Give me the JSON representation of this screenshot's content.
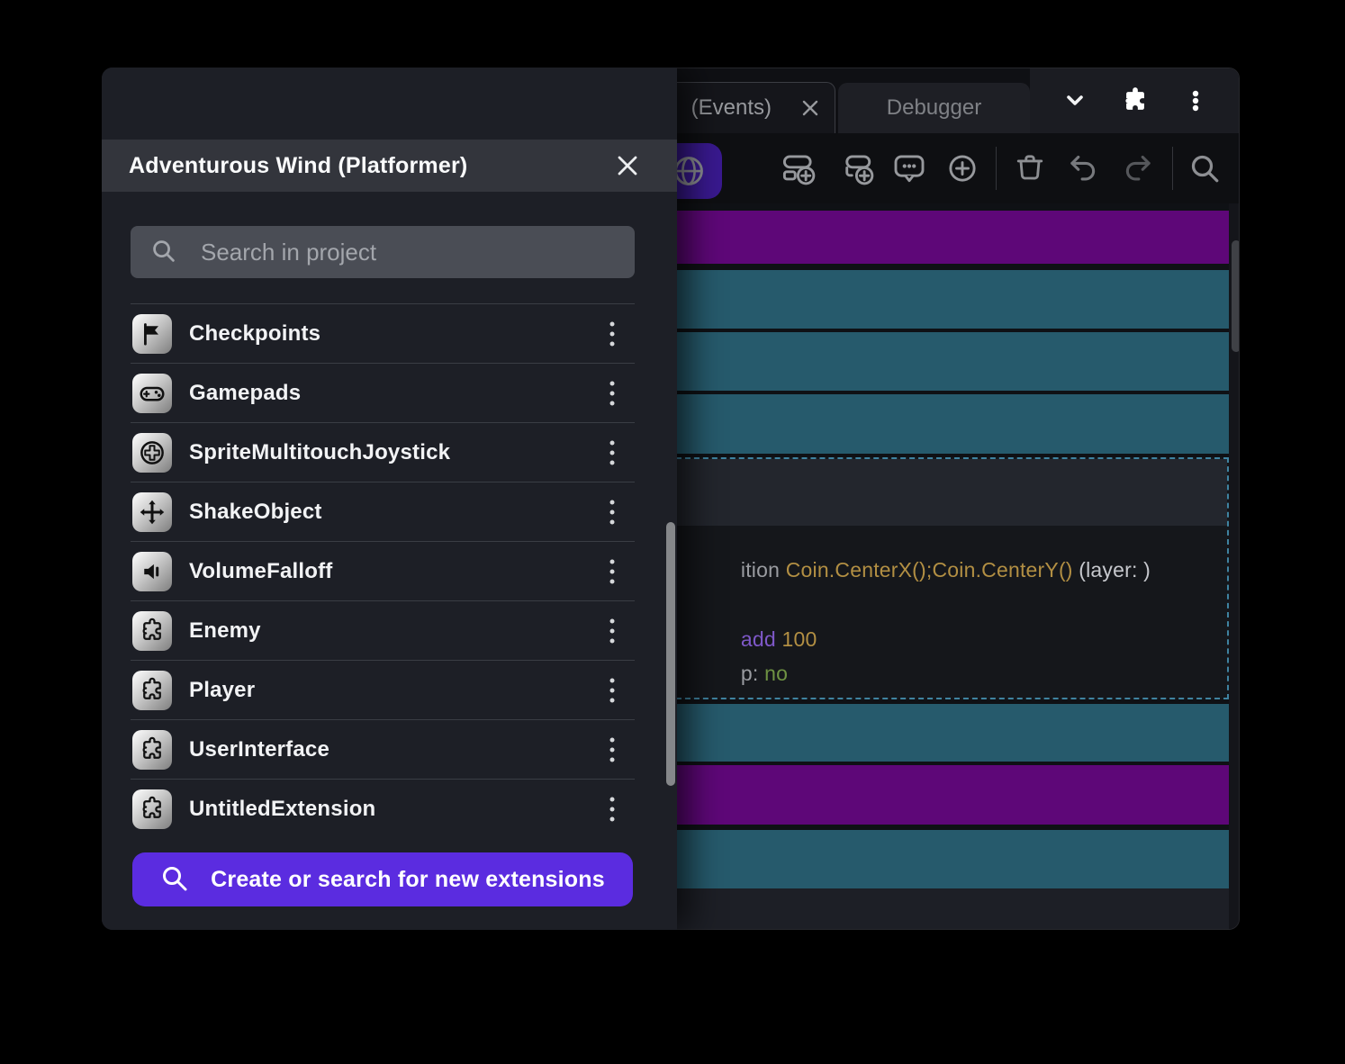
{
  "window": {
    "tabs": {
      "events_label": "(Events)",
      "debugger_label": "Debugger"
    }
  },
  "project_manager": {
    "title": "Adventurous Wind (Platformer)",
    "search_placeholder": "Search in project",
    "items": [
      {
        "label": "Checkpoints",
        "icon": "flag-icon"
      },
      {
        "label": "Gamepads",
        "icon": "gamepad-icon"
      },
      {
        "label": "SpriteMultitouchJoystick",
        "icon": "joystick-icon"
      },
      {
        "label": "ShakeObject",
        "icon": "move-arrows-icon"
      },
      {
        "label": "VolumeFalloff",
        "icon": "speaker-icon"
      },
      {
        "label": "Enemy",
        "icon": "puzzle-icon"
      },
      {
        "label": "Player",
        "icon": "puzzle-icon"
      },
      {
        "label": "UserInterface",
        "icon": "puzzle-icon"
      },
      {
        "label": "UntitledExtension",
        "icon": "puzzle-icon"
      }
    ],
    "create_button_label": "Create or search for new extensions"
  },
  "event_sheet": {
    "rows": [
      {
        "color": "#5e0778"
      },
      {
        "color": "#265a6c"
      },
      {
        "color": "#265a6c"
      },
      {
        "color": "#265a6c"
      },
      {
        "color": "#265a6c"
      },
      {
        "color": "#5e0778"
      },
      {
        "color": "#265a6c"
      }
    ],
    "selected_event_code": {
      "line1_pre": "ition ",
      "line1_expr": "Coin.CenterX();Coin.CenterY()",
      "line1_suffix": " (layer: )",
      "line2_keyword": "add ",
      "line2_value": "100",
      "line3_pre": "p: ",
      "line3_value": "no"
    }
  },
  "colors": {
    "accent_purple": "#5b2ce0",
    "toolbar_active_purple": "#39198f",
    "event_purple": "#5e0778",
    "event_teal": "#265a6c",
    "selection_border": "#3f83a0",
    "code_gray": "#9a9ca1",
    "code_gold": "#b28f43",
    "code_light": "#c6c8cd",
    "code_purple": "#7e58c8",
    "code_green": "#6f9343",
    "traffic_red": "#ef5850",
    "traffic_yellow": "#f5bd30",
    "traffic_green": "#2fc53d"
  }
}
